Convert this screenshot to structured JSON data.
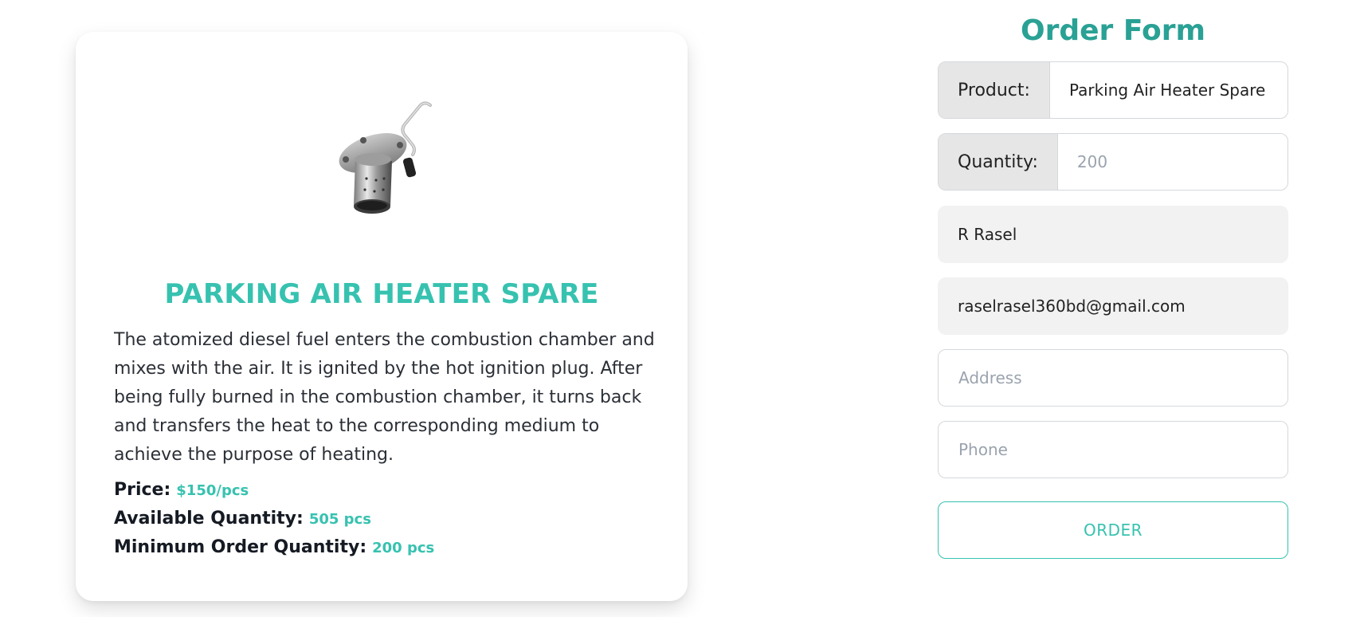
{
  "product": {
    "title": "PARKING AIR HEATER SPARE",
    "description": "The atomized diesel fuel enters the combustion chamber and mixes with the air. It is ignited by the hot ignition plug. After being fully burned in the combustion chamber, it turns back and transfers the heat to the corresponding medium to achieve the purpose of heating.",
    "image_icon": "heater-part-image",
    "specs": [
      {
        "label": "Price:",
        "value": "$150/pcs"
      },
      {
        "label": "Available Quantity:",
        "value": "505 pcs"
      },
      {
        "label": "Minimum Order Quantity:",
        "value": "200 pcs"
      }
    ]
  },
  "order_form": {
    "title": "Order Form",
    "product_label": "Product:",
    "product_value": "Parking Air Heater Spare",
    "quantity_label": "Quantity:",
    "quantity_placeholder": "200",
    "name_value": "R Rasel",
    "email_value": "raselrasel360bd@gmail.com",
    "address_placeholder": "Address",
    "phone_placeholder": "Phone",
    "submit_label": "ORDER"
  },
  "colors": {
    "accent": "#37c2b0",
    "form_title": "#2aa195"
  }
}
